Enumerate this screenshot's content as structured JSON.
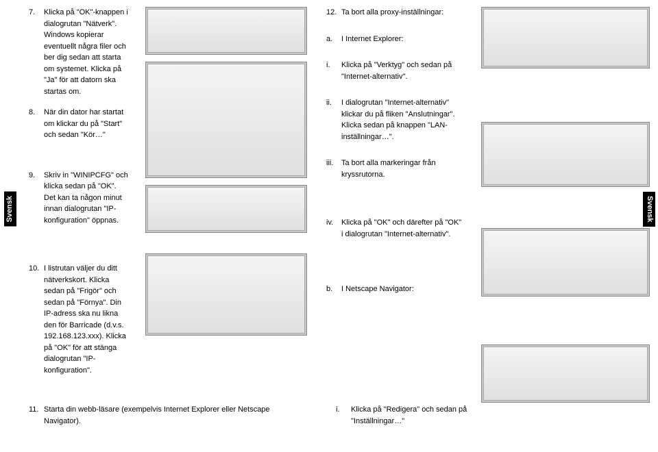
{
  "sideLabelLeft": "Svensk",
  "sideLabelRight": "Svensk",
  "col1": {
    "step7": {
      "num": "7.",
      "text": "Klicka på \"OK\"-knappen i dialogrutan \"Nätverk\". Windows kopierar eventuellt några filer och ber dig sedan att starta om systemet. Klicka på \"Ja\" för att datorn ska startas om."
    },
    "step8": {
      "num": "8.",
      "text": "När din dator har startat om klickar du på \"Start\" och sedan \"Kör…\""
    },
    "step9": {
      "num": "9.",
      "text": "Skriv in \"WINIPCFG\" och klicka sedan på \"OK\". Det kan ta någon minut innan dialogrutan \"IP-konfiguration\" öppnas."
    },
    "step10": {
      "num": "10.",
      "text": "I listrutan väljer du ditt nätverkskort. Klicka sedan på \"Frigör\" och sedan på \"Förnya\". Din IP-adress ska nu likna den för Barricade (d.v.s. 192.168.123.xxx). Klicka på \"OK\" för att stänga dialogrutan \"IP-konfiguration\"."
    },
    "step11": {
      "num": "11.",
      "text": "Starta din webb-läsare (exempelvis Internet Explorer eller Netscape Navigator)."
    }
  },
  "col3": {
    "step12": {
      "num": "12.",
      "text": "Ta bort alla proxy-inställningar:"
    },
    "a": {
      "num": "a.",
      "text": "I Internet Explorer:"
    },
    "i": {
      "num": "i.",
      "text": "Klicka på \"Verktyg\" och sedan på \"Internet-alternativ\"."
    },
    "ii": {
      "num": "ii.",
      "text": "I dialogrutan \"Internet-alternativ\" klickar du på fliken \"Anslutningar\". Klicka sedan på knappen \"LAN-inställningar…\"."
    },
    "iii": {
      "num": "iii.",
      "text": "Ta bort alla markeringar från kryssrutorna."
    },
    "iv": {
      "num": "iv.",
      "text": "Klicka på \"OK\" och därefter på \"OK\" i dialogrutan \"Internet-alternativ\"."
    },
    "b": {
      "num": "b.",
      "text": "I Netscape Navigator:"
    },
    "bi": {
      "num": "i.",
      "text": "Klicka på \"Redigera\" och sedan på \"Inställningar…\""
    }
  }
}
